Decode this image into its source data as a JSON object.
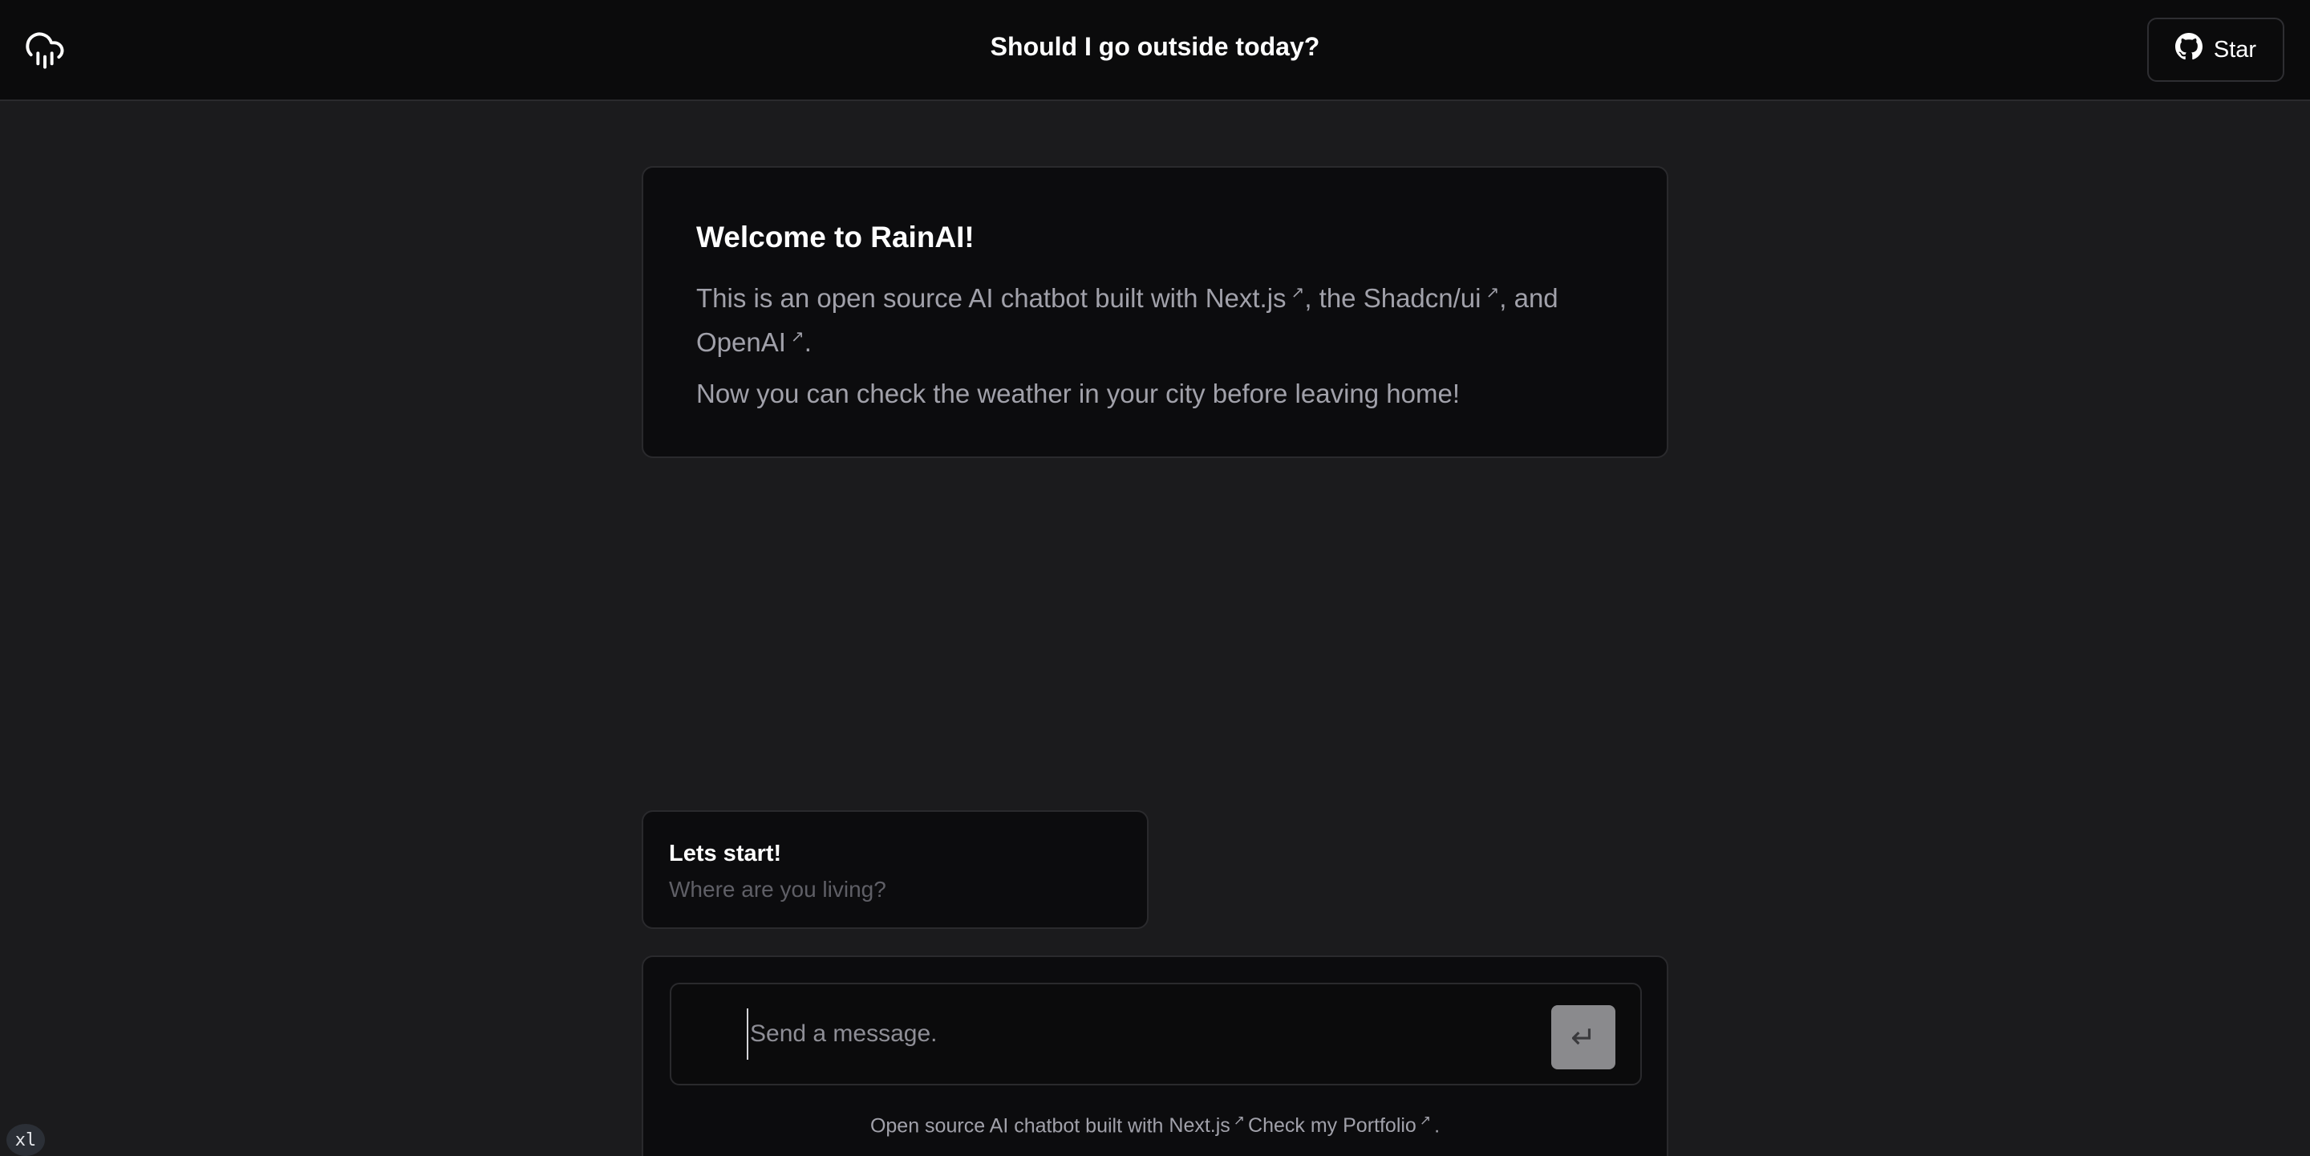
{
  "header": {
    "title": "Should I go outside today?",
    "logo_icon": "cloud-rain-icon",
    "star_button": {
      "label": "Star",
      "icon": "github-icon"
    }
  },
  "welcome": {
    "title": "Welcome to RainAI!",
    "intro_prefix": "This is an open source AI chatbot built with ",
    "link_nextjs": "Next.js",
    "sep1": ", the ",
    "link_shadcn": "Shadcn/ui",
    "sep2": ", and",
    "link_openai": "OpenAI",
    "end": ".",
    "second_line": "Now you can check the weather in your city before leaving home!",
    "external_marker": "↗"
  },
  "bot_message": {
    "title": "Lets start!",
    "text": "Where are you living?"
  },
  "composer": {
    "placeholder": "Send a message.",
    "send_icon": "↵",
    "footer_prefix": "Open source AI chatbot built with ",
    "footer_link_nextjs": "Next.js",
    "footer_link_portfolio": "Check my Portfolio",
    "footer_end": "."
  },
  "breakpoint_badge": "xl",
  "colors": {
    "background": "#1b1b1d",
    "header": "#0b0b0c",
    "card": "#0c0c0e",
    "muted_text": "#a1a1aa",
    "send_button": "#8a8a8d"
  }
}
